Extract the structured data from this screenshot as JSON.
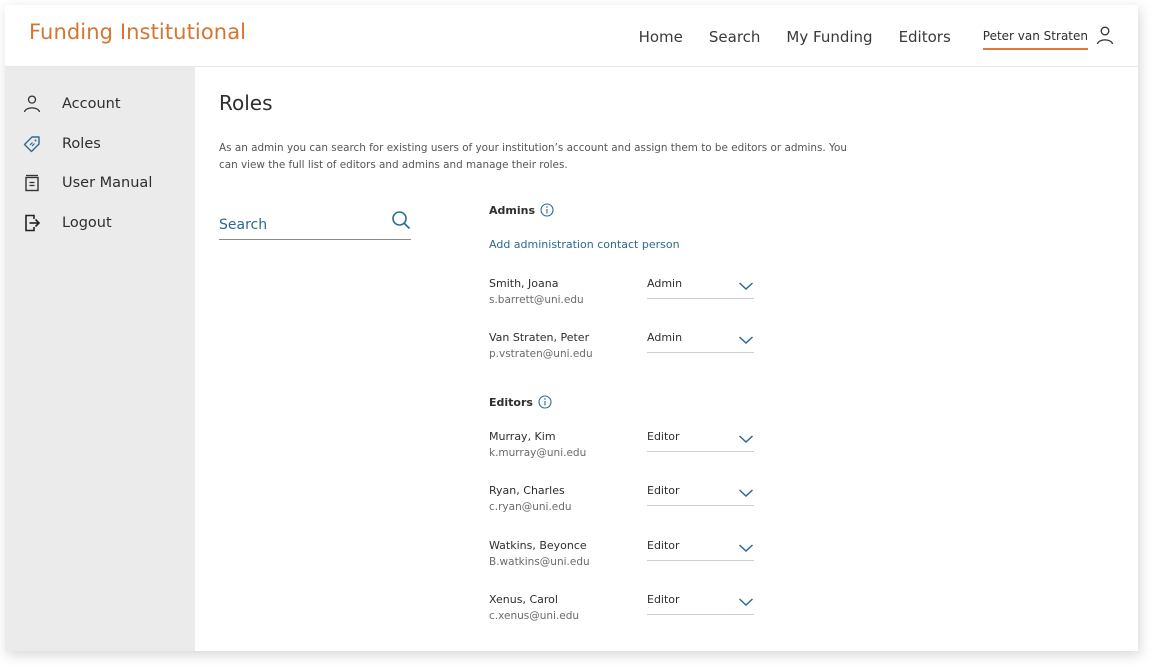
{
  "header": {
    "brand": "Funding Institutional",
    "nav": [
      "Home",
      "Search",
      "My Funding",
      "Editors"
    ],
    "user_name": "Peter van Straten",
    "user_icon": "user-icon"
  },
  "sidebar": {
    "items": [
      {
        "label": "Account",
        "icon": "user-icon",
        "active": false
      },
      {
        "label": "Roles",
        "icon": "tag-icon",
        "active": true
      },
      {
        "label": "User Manual",
        "icon": "manual-icon",
        "active": false
      },
      {
        "label": "Logout",
        "icon": "logout-icon",
        "active": false
      }
    ]
  },
  "main": {
    "title": "Roles",
    "description": "As an admin you can search for existing users of your institution’s account and assign them to be editors or admins. You can view the full list of editors and admins and manage their roles.",
    "search": {
      "placeholder": "Search",
      "value": ""
    },
    "admins": {
      "title": "Admins",
      "add_link": "Add administration contact person",
      "people": [
        {
          "name": "Smith, Joana",
          "email": "s.barrett@uni.edu",
          "role": "Admin"
        },
        {
          "name": "Van Straten, Peter",
          "email": "p.vstraten@uni.edu",
          "role": "Admin"
        }
      ]
    },
    "editors": {
      "title": "Editors",
      "people": [
        {
          "name": "Murray, Kim",
          "email": "k.murray@uni.edu",
          "role": "Editor"
        },
        {
          "name": "Ryan, Charles",
          "email": "c.ryan@uni.edu",
          "role": "Editor"
        },
        {
          "name": "Watkins, Beyonce",
          "email": "B.watkins@uni.edu",
          "role": "Editor"
        },
        {
          "name": "Xenus, Carol",
          "email": "c.xenus@uni.edu",
          "role": "Editor"
        }
      ]
    }
  },
  "colors": {
    "brand": "#d7742f",
    "accent": "#2c6a8f",
    "sidebar_bg": "#ebebeb",
    "active_underline": "#e07a3a"
  }
}
